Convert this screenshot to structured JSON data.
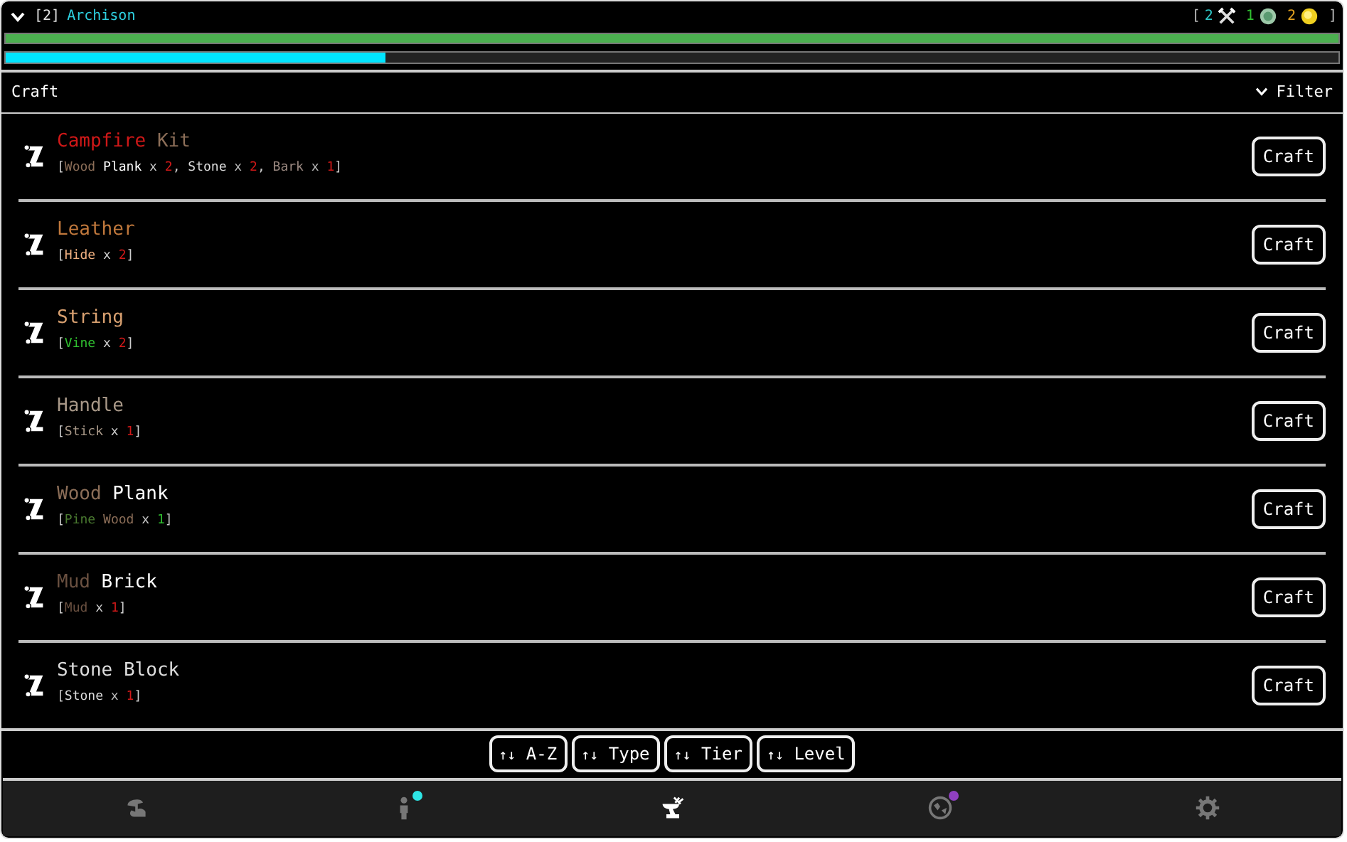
{
  "header": {
    "expanded": true,
    "slot": "[2]",
    "name": "Archison",
    "stats": [
      {
        "kind": "plain",
        "text": "[",
        "color": "#bbbbbb"
      },
      {
        "kind": "tools",
        "text": "2",
        "color": "#2ec4c4"
      },
      {
        "kind": "jade",
        "text": "1",
        "color": "#30c030"
      },
      {
        "kind": "gold",
        "text": "2",
        "color": "#e0a020"
      },
      {
        "kind": "plain",
        "text": "]",
        "color": "#bbbbbb"
      }
    ]
  },
  "bars": [
    {
      "kind": "health",
      "level": 1.0
    },
    {
      "kind": "experience",
      "level": 0.285
    }
  ],
  "panel": {
    "title": "Craft",
    "filter": "Filter",
    "filter_expanded": true
  },
  "recipes": [
    {
      "name": [
        {
          "text": "Campfire",
          "color": "#d01818"
        },
        {
          "text": " Kit",
          "color": "#8c6e58"
        }
      ],
      "ingredients": [
        {
          "text": "[",
          "color": "#cccccc"
        },
        {
          "text": "Wood",
          "color": "#8c6e58"
        },
        {
          "text": " Plank",
          "color": "#ffffff"
        },
        {
          "text": " x",
          "color": "#cccccc"
        },
        {
          "text": " 2",
          "color": "#d01818"
        },
        {
          "text": ",",
          "color": "#cccccc"
        },
        {
          "text": " Stone",
          "color": "#dddddd"
        },
        {
          "text": " x",
          "color": "#bbbbbb"
        },
        {
          "text": " 2",
          "color": "#d01818"
        },
        {
          "text": ",",
          "color": "#cccccc"
        },
        {
          "text": " Bark",
          "color": "#9a8880"
        },
        {
          "text": " x",
          "color": "#bbbbbb"
        },
        {
          "text": " 1",
          "color": "#d01818"
        },
        {
          "text": "]",
          "color": "#cccccc"
        }
      ],
      "button": "Craft"
    },
    {
      "name": [
        {
          "text": "Leather",
          "color": "#c0783c"
        }
      ],
      "ingredients": [
        {
          "text": "[",
          "color": "#cccccc"
        },
        {
          "text": "Hide",
          "color": "#f0b080"
        },
        {
          "text": " x",
          "color": "#cccccc"
        },
        {
          "text": " 2",
          "color": "#d01818"
        },
        {
          "text": "]",
          "color": "#cccccc"
        }
      ],
      "button": "Craft"
    },
    {
      "name": [
        {
          "text": "String",
          "color": "#d8a070"
        }
      ],
      "ingredients": [
        {
          "text": "[",
          "color": "#cccccc"
        },
        {
          "text": "Vine",
          "color": "#30c030"
        },
        {
          "text": " x",
          "color": "#cccccc"
        },
        {
          "text": " 2",
          "color": "#d01818"
        },
        {
          "text": "]",
          "color": "#cccccc"
        }
      ],
      "button": "Craft"
    },
    {
      "name": [
        {
          "text": "Handle",
          "color": "#a89888"
        }
      ],
      "ingredients": [
        {
          "text": "[",
          "color": "#cccccc"
        },
        {
          "text": "Stick",
          "color": "#a89888"
        },
        {
          "text": " x",
          "color": "#cccccc"
        },
        {
          "text": " 1",
          "color": "#d01818"
        },
        {
          "text": "]",
          "color": "#cccccc"
        }
      ],
      "button": "Craft"
    },
    {
      "name": [
        {
          "text": "Wood",
          "color": "#8c6e58"
        },
        {
          "text": " Plank",
          "color": "#ffffff"
        }
      ],
      "ingredients": [
        {
          "text": "[",
          "color": "#cccccc"
        },
        {
          "text": "Pine",
          "color": "#4a7a30"
        },
        {
          "text": " Wood",
          "color": "#8c6e58"
        },
        {
          "text": " x",
          "color": "#cccccc"
        },
        {
          "text": " 1",
          "color": "#30c030"
        },
        {
          "text": "]",
          "color": "#cccccc"
        }
      ],
      "button": "Craft"
    },
    {
      "name": [
        {
          "text": "Mud",
          "color": "#6a5040"
        },
        {
          "text": " Brick",
          "color": "#ffffff"
        }
      ],
      "ingredients": [
        {
          "text": "[",
          "color": "#cccccc"
        },
        {
          "text": "Mud",
          "color": "#6a5040"
        },
        {
          "text": " x",
          "color": "#cccccc"
        },
        {
          "text": " 1",
          "color": "#d01818"
        },
        {
          "text": "]",
          "color": "#cccccc"
        }
      ],
      "button": "Craft"
    },
    {
      "name": [
        {
          "text": "Stone Block",
          "color": "#dddddd"
        }
      ],
      "ingredients": [
        {
          "text": "[",
          "color": "#cccccc"
        },
        {
          "text": "Stone",
          "color": "#dddddd"
        },
        {
          "text": " x",
          "color": "#bbbbbb"
        },
        {
          "text": " 1",
          "color": "#d01818"
        },
        {
          "text": "]",
          "color": "#cccccc"
        }
      ],
      "button": "Craft"
    }
  ],
  "sort_buttons": [
    {
      "arrows": "↑↓",
      "label": "A-Z"
    },
    {
      "arrows": "↑↓",
      "label": "Type"
    },
    {
      "arrows": "↑↓",
      "label": "Tier"
    },
    {
      "arrows": "↑↓",
      "label": "Level"
    }
  ],
  "nav": [
    {
      "kind": "map",
      "selected": false
    },
    {
      "kind": "character",
      "selected": false,
      "color": "#2ee6e6"
    },
    {
      "kind": "craft",
      "selected": true
    },
    {
      "kind": "world",
      "selected": false,
      "color": "#9040c0"
    },
    {
      "kind": "settings",
      "selected": false
    }
  ]
}
